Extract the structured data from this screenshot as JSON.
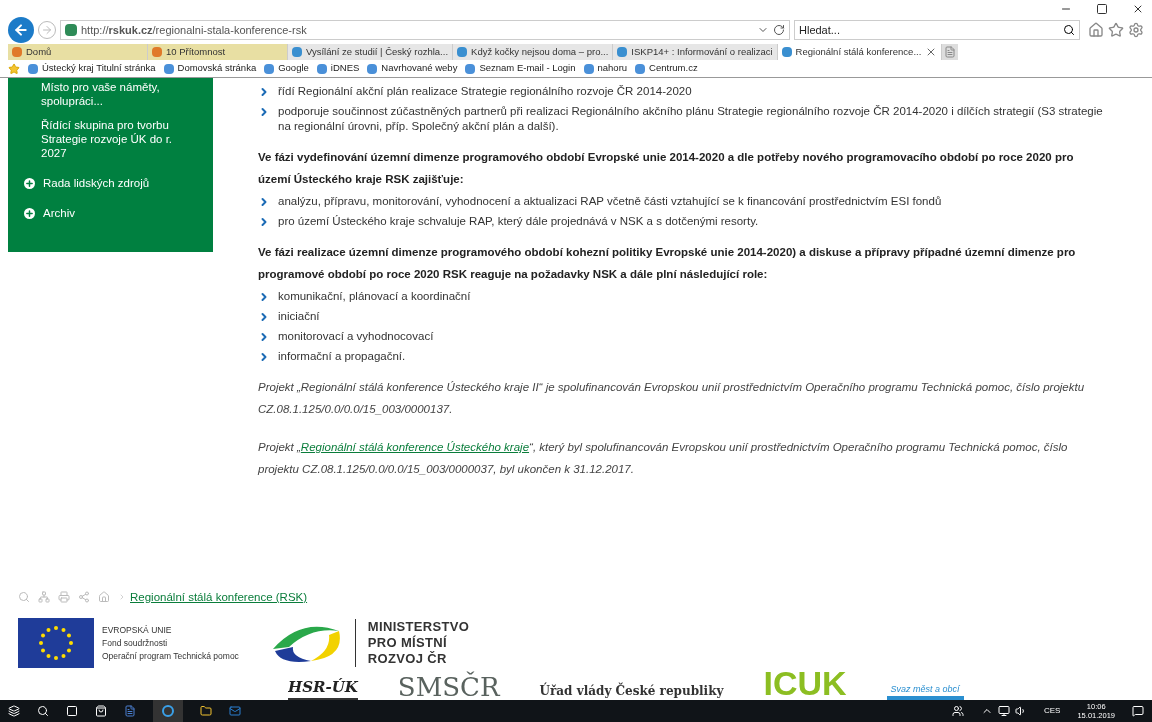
{
  "browser": {
    "address": "http://**rskuk.cz**/regionalni-stala-konference-rsk",
    "search": {
      "placeholder": "Hledat..."
    },
    "tabs": [
      {
        "label": "Domů",
        "selected": false,
        "pinned": true
      },
      {
        "label": "10 Přítomnost",
        "selected": false,
        "pinned": true
      },
      {
        "label": "Vysílání ze studií | Český rozhla...",
        "selected": false,
        "pinned": false
      },
      {
        "label": "Když kočky nejsou doma – pro...",
        "selected": false,
        "pinned": false
      },
      {
        "label": "ISKP14+ : Informování o realizaci",
        "selected": false,
        "pinned": false
      },
      {
        "label": "Regionální stálá konference...",
        "selected": true,
        "pinned": false
      }
    ],
    "favorites": [
      "Ústecký kraj Titulní stránka",
      "Domovská stránka",
      "Google",
      "iDNES",
      "Navrhované weby",
      "Seznam E-mail - Login",
      "nahoru",
      "Centrum.cz"
    ]
  },
  "sidebar": {
    "items": [
      {
        "label": "Místo pro vaše náměty, spolupráci...",
        "kind": "sub"
      },
      {
        "label": "Řídící skupina pro tvorbu Strategie rozvoje ÚK do r. 2027",
        "kind": "sub"
      },
      {
        "label": "Rada lidských zdrojů",
        "kind": "expandable"
      },
      {
        "label": "Archiv",
        "kind": "expandable"
      }
    ]
  },
  "content": [
    {
      "kind": "bullets",
      "items": [
        "řídí Regionální akční plán realizace Strategie regionálního rozvoje ČR 2014-2020",
        "podporuje součinnost zúčastněných partnerů při realizaci Regionálního akčního plánu Strategie regionálního rozvoje ČR 2014-2020 i dílčích strategií (S3 strategie na regionální úrovni, příp. Společný akční plán a další)."
      ]
    },
    {
      "kind": "heading",
      "text": "Ve fázi vydefinování územní dimenze programového období Evropské unie 2014-2020 a dle potřeby nového programovacího období po roce 2020 pro území Ústeckého kraje RSK zajišťuje:"
    },
    {
      "kind": "bullets",
      "items": [
        "analýzu, přípravu, monitorování, vyhodnocení a aktualizaci RAP včetně části vztahující se k financování prostřednictvím ESI fondů",
        "pro území Ústeckého kraje schvaluje RAP, který dále projednává v NSK a s dotčenými resorty."
      ]
    },
    {
      "kind": "heading",
      "text": "Ve fázi realizace územní dimenze programového období kohezní politiky Evropské unie 2014-2020) a diskuse a přípravy případné územní dimenze pro programové období po roce 2020 RSK reaguje na požadavky NSK a dále plní následující role:"
    },
    {
      "kind": "bullets",
      "items": [
        "komunikační, plánovací a koordinační",
        "iniciační",
        "monitorovací a vyhodnocovací",
        "informační a propagační."
      ]
    },
    {
      "kind": "note",
      "before": "Projekt „Regionální stálá konference Ústeckého kraje II“ je spolufinancován Evropskou unií prostřednictvím Operačního programu Technická pomoc, číslo projektu CZ.08.1.125/0.0/0.0/15_003/0000137."
    },
    {
      "kind": "note",
      "before": "Projekt „",
      "link": "Regionální stálá konference Ústeckého kraje",
      "after": "“, který byl spolufinancován Evropskou unií prostřednictvím Operačního programu Technická pomoc, číslo projektu CZ.08.1.125/0.0/0.0/15_003/0000037,  byl ukončen k 31.12.2017."
    }
  ],
  "breadcrumb": "Regionální stálá konference (RSK)",
  "eu_logo": [
    "EVROPSKÁ UNIE",
    "Fond soudržnosti",
    "Operační program Technická pomoc"
  ],
  "ministry_logo": [
    "MINISTERSTVO",
    "PRO MÍSTNÍ",
    "ROZVOJ ČR"
  ],
  "partners": [
    {
      "kind": "plain",
      "text": "HSR-ÚK"
    },
    {
      "kind": "sms",
      "text": "SMSČR"
    },
    {
      "kind": "gov",
      "text": "Úřad vlády České republiky"
    },
    {
      "kind": "icuk",
      "text": "ICUK"
    },
    {
      "kind": "svaz",
      "text": "Svaz měst a obcí"
    }
  ],
  "taskbar": {
    "language": "CES",
    "time": "10:06",
    "date": "15.01.2019"
  }
}
